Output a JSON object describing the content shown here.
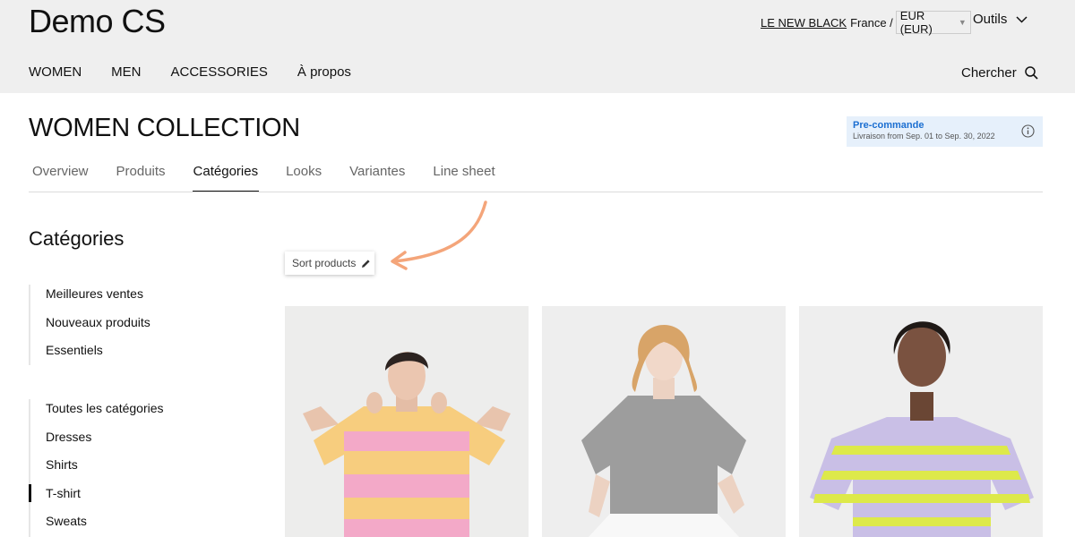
{
  "header": {
    "logo": "Demo CS",
    "brand_link": "LE NEW BLACK",
    "country": "France /",
    "currency": "EUR (EUR)",
    "tools_label": "Outils",
    "search_label": "Chercher"
  },
  "nav": {
    "items": [
      {
        "label": "WOMEN"
      },
      {
        "label": "MEN"
      },
      {
        "label": "ACCESSORIES"
      },
      {
        "label": "À propos"
      }
    ]
  },
  "page": {
    "title": "WOMEN COLLECTION"
  },
  "precommande": {
    "title": "Pre-commande",
    "subtitle": "Livraison from Sep. 01 to Sep. 30, 2022"
  },
  "tabs": [
    {
      "label": "Overview"
    },
    {
      "label": "Produits"
    },
    {
      "label": "Catégories",
      "active": true
    },
    {
      "label": "Looks"
    },
    {
      "label": "Variantes"
    },
    {
      "label": "Line sheet"
    }
  ],
  "sidebar": {
    "title": "Catégories",
    "group1": [
      {
        "label": "Meilleures ventes"
      },
      {
        "label": "Nouveaux produits"
      },
      {
        "label": "Essentiels"
      }
    ],
    "group2": [
      {
        "label": "Toutes les catégories"
      },
      {
        "label": "Dresses"
      },
      {
        "label": "Shirts"
      },
      {
        "label": "T-shirt",
        "active": true
      },
      {
        "label": "Sweats"
      }
    ]
  },
  "sort": {
    "label": "Sort products"
  },
  "colors": {
    "accent_blue": "#1c6fd1",
    "arrow_orange": "#f4a57a",
    "header_bg": "#efefef"
  }
}
